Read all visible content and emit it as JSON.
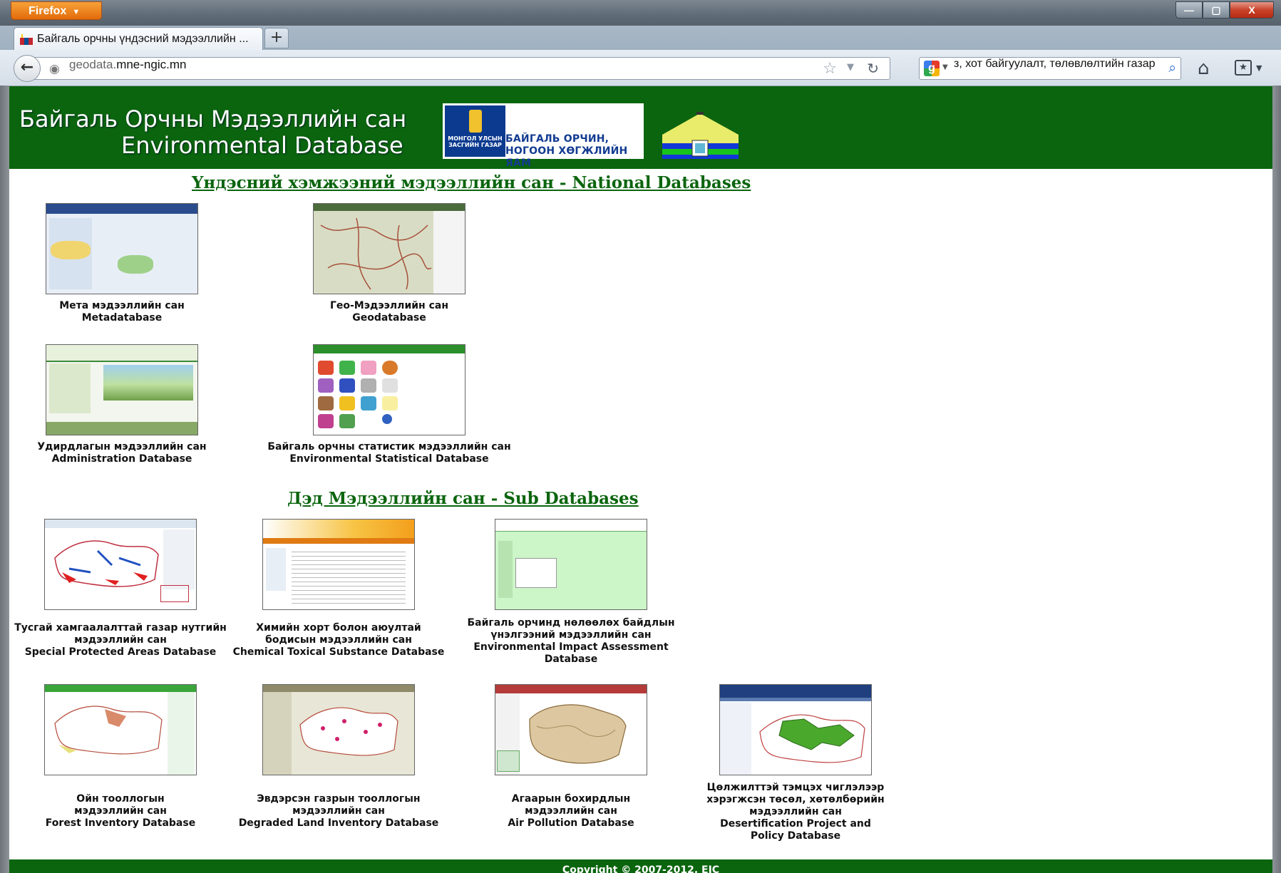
{
  "browser": {
    "app_button": "Firefox",
    "tab_title": "Байгаль орчны үндэсний мэдээллийн ...",
    "url_domain_prefix": "geodata.",
    "url_domain_main": "mne-ngic.mn",
    "search_text": "з, хот байгуулалт, төлөвлөлтийн газар",
    "new_tab_label": "+",
    "window_controls": {
      "minimize": "—",
      "maximize": "▢",
      "close": "X"
    }
  },
  "header": {
    "title_mn": "Байгаль Орчны Мэдээллийн сан",
    "title_en": "Environmental Database",
    "ministry_line1": "БАЙГАЛЬ ОРЧИН,",
    "ministry_line2": "НОГООН ХӨГЖЛИЙН ЯАМ",
    "emblem_text": "МОНГОЛ УЛСЫН ЗАСГИЙН ГАЗАР"
  },
  "national": {
    "title": "Үндэсний хэмжээний мэдээллийн сан - National Databases",
    "items": [
      {
        "mn": "Мета мэдээллийн сан",
        "en": "Metadatabase"
      },
      {
        "mn": "Гео-Мэдээллийн сан",
        "en": "Geodatabase"
      },
      {
        "mn": "Удирдлагын мэдээллийн сан",
        "en": "Administration Database"
      },
      {
        "mn": "Байгаль орчны статистик мэдээллийн сан",
        "en": "Environmental Statistical Database"
      }
    ]
  },
  "sub": {
    "title": "Дэд Мэдээллийн сан - Sub Databases",
    "items": [
      {
        "mn1": "Тусгай хамгаалалттай газар нутгийн",
        "mn2": "мэдээллийн сан",
        "en1": "Special Protected Areas Database",
        "en2": ""
      },
      {
        "mn1": "Химийн хорт болон аюултай",
        "mn2": "бодисын мэдээллийн сан",
        "en1": "Chemical Toxical Substance Database",
        "en2": ""
      },
      {
        "mn1": "Байгаль орчинд нөлөөлөх байдлын",
        "mn2": "үнэлгээний мэдээллийн сан",
        "en1": "Environmental Impact Assessment",
        "en2": "Database"
      },
      {
        "mn1": "Ойн тооллогын",
        "mn2": "мэдээллийн сан",
        "en1": "Forest Inventory Database",
        "en2": ""
      },
      {
        "mn1": "Эвдэрсэн газрын тооллогын",
        "mn2": "мэдээллийн сан",
        "en1": "Degraded Land Inventory Database",
        "en2": ""
      },
      {
        "mn1": "Агаарын бохирдлын",
        "mn2": "мэдээллийн сан",
        "en1": "Air Pollution Database",
        "en2": ""
      },
      {
        "mn1": "Цөлжилттэй тэмцэх чиглэлээр",
        "mn2": "хэрэгжсэн төсөл, хөтөлбөрийн",
        "en1": "мэдээллийн сан",
        "en2": "Desertification Project and",
        "en3": "Policy Database"
      }
    ]
  },
  "footer": {
    "text": "Copyright © 2007-2012, EIC"
  },
  "colors": {
    "brand_green": "#0b650e",
    "ministry_blue": "#123b91"
  }
}
